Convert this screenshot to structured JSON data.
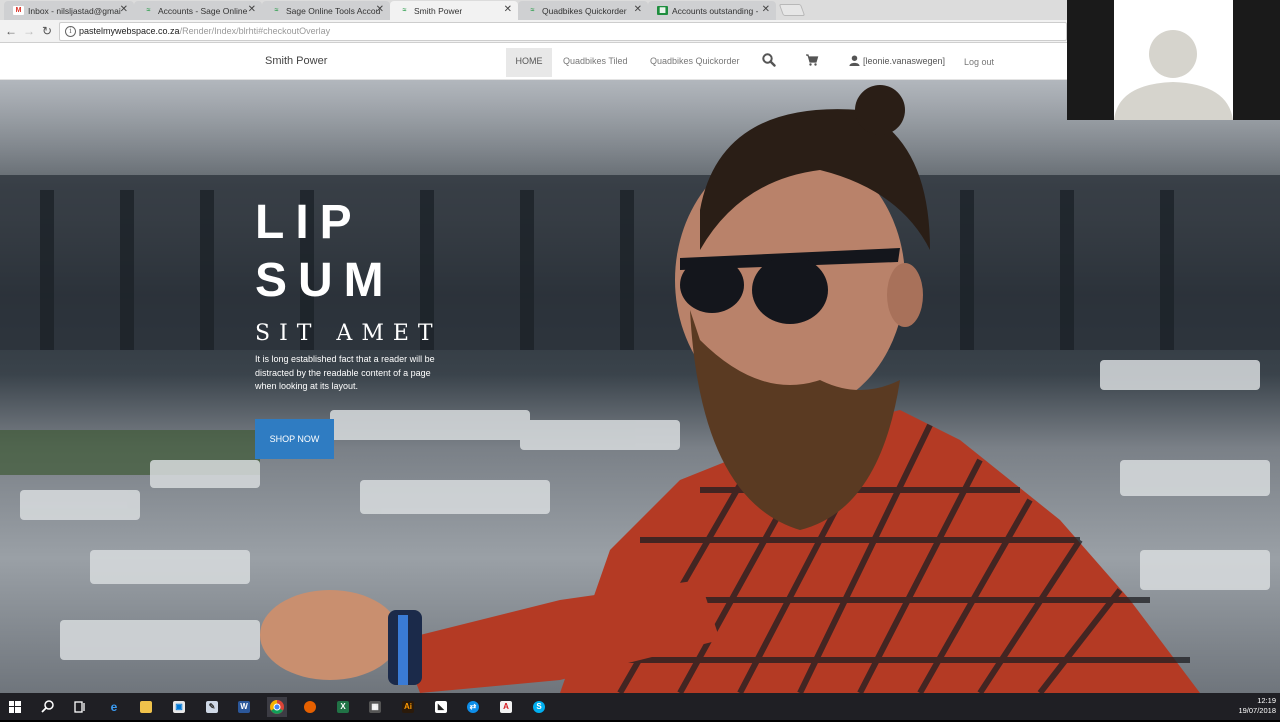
{
  "browser": {
    "tabs": [
      {
        "label": "Inbox - nilsljastad@gmai",
        "icon": "gmail-icon",
        "active": false
      },
      {
        "label": "Accounts - Sage Online",
        "icon": "sage-icon",
        "active": false
      },
      {
        "label": "Sage Online Tools Accou",
        "icon": "sage-icon",
        "active": false
      },
      {
        "label": "Smith Power",
        "icon": "sage-icon",
        "active": true
      },
      {
        "label": "Quadbikes Quickorder",
        "icon": "sage-icon",
        "active": false
      },
      {
        "label": "Accounts outstanding - ",
        "icon": "sheets-icon",
        "active": false
      }
    ],
    "url_host": "pastelmywebspace.co.za",
    "url_path": "/Render/Index/blrhti#checkoutOverlay"
  },
  "site": {
    "brand": "Smith Power",
    "nav": {
      "home": "HOME",
      "quadbikes_tiled": "Quadbikes Tiled",
      "quadbikes_quickorder": "Quadbikes Quickorder",
      "user": "[leonie.vanaswegen]",
      "logout": "Log out"
    }
  },
  "hero": {
    "line1": "LIP",
    "line2": "SUM",
    "subtitle": "SIT AMET",
    "description": "It is long established fact that a reader will be distracted by the readable content of a page when looking at its layout.",
    "button": "SHOP NOW"
  },
  "taskbar": {
    "time": "12:19",
    "date": "19/07/2018",
    "apps": [
      "start-icon",
      "search-icon",
      "task-view-icon",
      "edge-icon",
      "file-explorer-icon",
      "store-icon",
      "paint-icon",
      "word-icon",
      "chrome-icon",
      "firefox-icon",
      "excel-icon",
      "calculator-icon",
      "illustrator-icon",
      "notepad-icon",
      "teamviewer-icon",
      "acrobat-icon",
      "skype-icon"
    ]
  },
  "colors": {
    "accent": "#2f7cc2",
    "nav_active_bg": "#e8e8e8",
    "taskbar": "#1f1f24"
  }
}
